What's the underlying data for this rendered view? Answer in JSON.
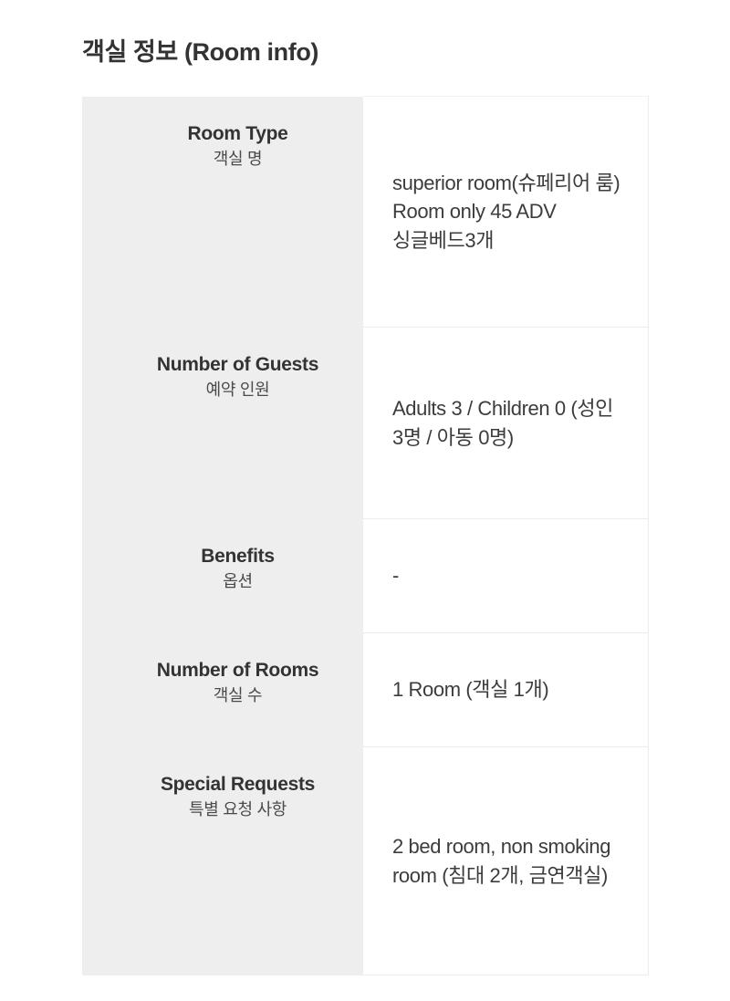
{
  "header": {
    "title": "객실 정보 (Room info)"
  },
  "room_info": {
    "rows": [
      {
        "label_en": "Room Type",
        "label_ko": "객실 명",
        "value": "superior room(슈페리어 룸) Room only 45 ADV 싱글베드3개"
      },
      {
        "label_en": "Number of Guests",
        "label_ko": "예약 인원",
        "value": "Adults 3 / Children 0 (성인 3명 / 아동 0명)"
      },
      {
        "label_en": "Benefits",
        "label_ko": "옵션",
        "value": "-"
      },
      {
        "label_en": "Number of Rooms",
        "label_ko": "객실 수",
        "value": "1 Room (객실 1개)"
      },
      {
        "label_en": "Special Requests",
        "label_ko": "특별 요청 사항",
        "value": "2 bed room, non smoking room (침대 2개, 금연객실)"
      }
    ]
  },
  "colors": {
    "page_background": "#ffffff",
    "label_column_background": "#eeeeee",
    "value_column_background": "#ffffff",
    "border": "#ececec",
    "title_text": "#333333",
    "label_en_text": "#333333",
    "label_ko_text": "#4a4a4a",
    "value_text": "#3c3c3c"
  }
}
